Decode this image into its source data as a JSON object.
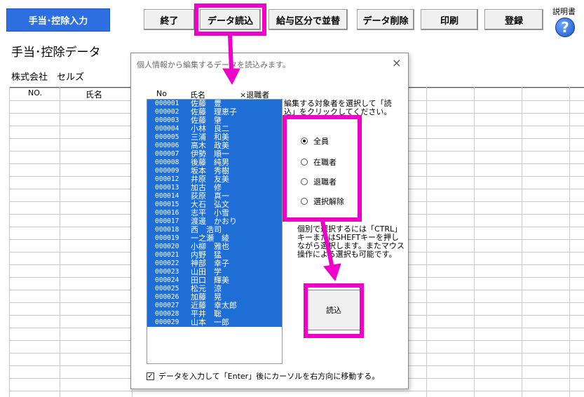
{
  "mode_button": "手当･控除入力",
  "page_title": "手当･控除データ",
  "company": "株式会社　セルズ",
  "toolbar": {
    "exit": "終了",
    "load": "データ読込",
    "sort": "給与区分で並替",
    "delete": "データ削除",
    "print": "印刷",
    "register": "登録"
  },
  "help_label": "説明書",
  "help_icon_glyph": "?",
  "grid": {
    "col_no": "NO.",
    "col_name": "氏名"
  },
  "dialog": {
    "title": "個人情報から編集するデータを読込みます。",
    "close": "×",
    "list_header": {
      "no": "No",
      "name": "氏名",
      "retired": "×退職者"
    },
    "employees": [
      {
        "id": "000001",
        "name": "佐藤　豊"
      },
      {
        "id": "000002",
        "name": "佐藤　理恵子"
      },
      {
        "id": "000003",
        "name": "佐藤　肇"
      },
      {
        "id": "000004",
        "name": "小林　良二"
      },
      {
        "id": "000005",
        "name": "三浦　和美"
      },
      {
        "id": "000006",
        "name": "高木　政美"
      },
      {
        "id": "000007",
        "name": "伊勢　順一"
      },
      {
        "id": "000008",
        "name": "後藤　純男"
      },
      {
        "id": "000009",
        "name": "坂本　秀樹"
      },
      {
        "id": "000012",
        "name": "井原　友美"
      },
      {
        "id": "000013",
        "name": "加古　修"
      },
      {
        "id": "000014",
        "name": "荻原　真一"
      },
      {
        "id": "000015",
        "name": "大石　弘文"
      },
      {
        "id": "000016",
        "name": "志平　小雪"
      },
      {
        "id": "000017",
        "name": "渡邊　かおり"
      },
      {
        "id": "000018",
        "name": "西　浩司"
      },
      {
        "id": "000019",
        "name": "一之瀬　綾"
      },
      {
        "id": "000020",
        "name": "小柳　雅也"
      },
      {
        "id": "000021",
        "name": "内野　猛"
      },
      {
        "id": "000022",
        "name": "神部　幸子"
      },
      {
        "id": "000023",
        "name": "山田　学"
      },
      {
        "id": "000024",
        "name": "田口　輝美"
      },
      {
        "id": "000025",
        "name": "松元　涼"
      },
      {
        "id": "000026",
        "name": "加藤　晃"
      },
      {
        "id": "000027",
        "name": "近藤　幸太郎"
      },
      {
        "id": "000028",
        "name": "平井　聡"
      },
      {
        "id": "000029",
        "name": "山本　一郎"
      }
    ],
    "instruction": "編集する対象者を選択して「読込」をクリックしてください。",
    "radios": [
      {
        "label": "全員",
        "selected": true
      },
      {
        "label": "在職者",
        "selected": false
      },
      {
        "label": "退職者",
        "selected": false
      },
      {
        "label": "選択解除",
        "selected": false
      }
    ],
    "note": "個別で選択するには「CTRL」キーまたはSHEFTキーを押しながら選択します。またマウス操作による選択も可能です。",
    "load_button": "読込",
    "enter_checkbox": {
      "checked": true,
      "label": "データを入力して「Enter」後にカーソルを右方向に移動する。"
    }
  },
  "colors": {
    "mode_button": "#2d6fe0",
    "list_selection": "#1e6ed6",
    "highlight": "#ee00c8"
  }
}
